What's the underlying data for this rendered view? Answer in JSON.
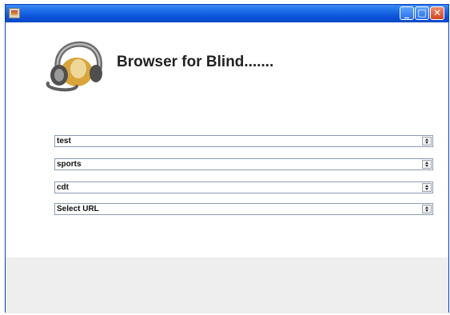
{
  "window": {
    "title": "",
    "controls": {
      "minimize": "_",
      "maximize": "□",
      "close": "✕"
    },
    "icon": "java-app-icon"
  },
  "header": {
    "logo": "headphones-icon",
    "title": "Browser for Blind......."
  },
  "fields": [
    {
      "value": "test"
    },
    {
      "value": "sports"
    },
    {
      "value": "cdt"
    },
    {
      "value": "Select URL"
    }
  ],
  "colors": {
    "titlebar": "#0a52d8",
    "close": "#d4451e",
    "panel": "#eeeeee"
  }
}
